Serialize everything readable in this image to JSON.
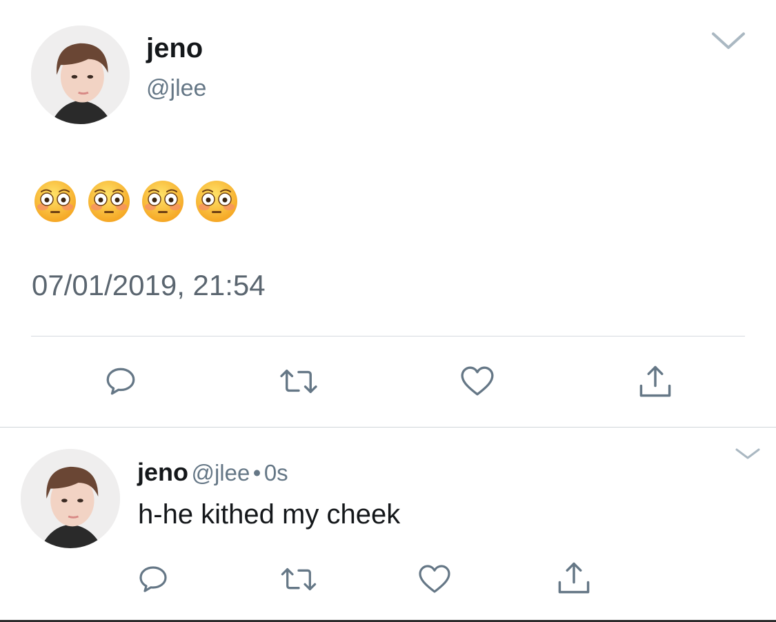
{
  "main_tweet": {
    "display_name": "jeno",
    "handle": "@jlee",
    "emoji_count": 4,
    "emoji_icon": "flushed-face-emoji",
    "timestamp": "07/01/2019, 21:54",
    "actions": [
      "reply-icon",
      "retweet-icon",
      "like-icon",
      "share-icon"
    ]
  },
  "reply_tweet": {
    "display_name": "jeno",
    "handle": "@jlee",
    "separator": "•",
    "time_ago": "0s",
    "text": "h-he kithed my cheek",
    "actions": [
      "reply-icon",
      "retweet-icon",
      "like-icon",
      "share-icon"
    ]
  },
  "colors": {
    "primary_text": "#14171a",
    "secondary_text": "#657786",
    "icon": "#657786",
    "divider": "#d5dadf"
  }
}
